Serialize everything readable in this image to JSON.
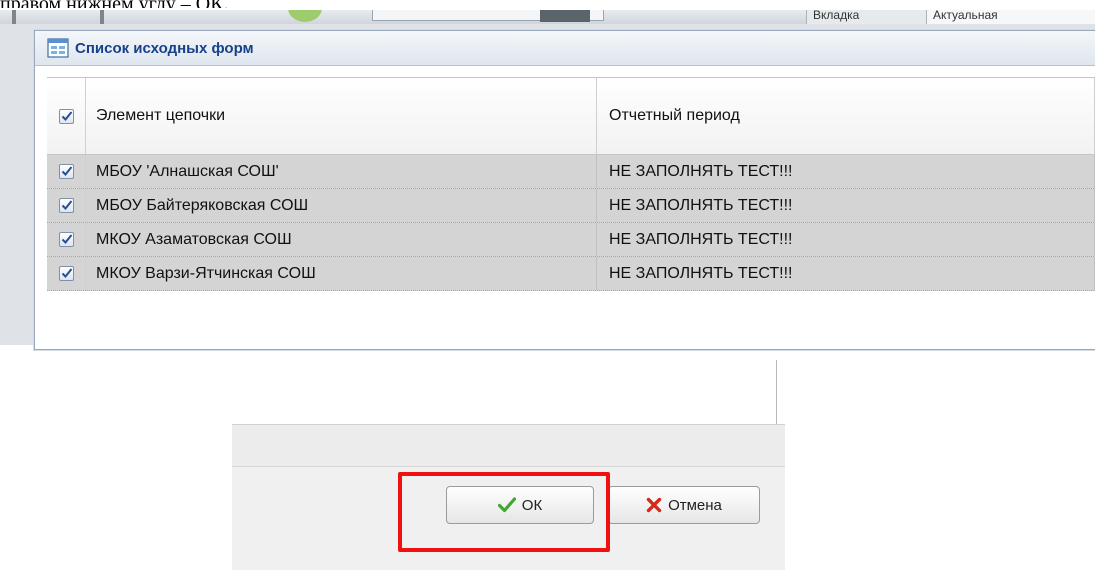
{
  "doc_fragment": "правом нижнем углу – ОК.",
  "background_tabs": [
    "Вкладка",
    "Актуальная"
  ],
  "dialog": {
    "title": "Список исходных форм",
    "columns": {
      "element": "Элемент цепочки",
      "period": "Отчетный период"
    },
    "rows": [
      {
        "element": "МБОУ 'Алнашская СОШ'",
        "period": "НЕ ЗАПОЛНЯТЬ ТЕСТ!!!",
        "checked": true
      },
      {
        "element": "МБОУ Байтеряковская СОШ",
        "period": "НЕ ЗАПОЛНЯТЬ ТЕСТ!!!",
        "checked": true
      },
      {
        "element": "МКОУ Азаматовская СОШ",
        "period": "НЕ ЗАПОЛНЯТЬ ТЕСТ!!!",
        "checked": true
      },
      {
        "element": "МКОУ Варзи-Ятчинская СОШ",
        "period": "НЕ ЗАПОЛНЯТЬ ТЕСТ!!!",
        "checked": true
      }
    ]
  },
  "buttons": {
    "ok_label": "ОК",
    "cancel_label": "Отмена"
  },
  "icons": {
    "dialog": "window-grid-icon",
    "ok": "check-icon",
    "cancel": "cross-icon"
  },
  "colors": {
    "title": "#15428b",
    "highlight": "#f01010",
    "ok_icon": "#3ea82f",
    "cancel_icon": "#d42a1e"
  }
}
